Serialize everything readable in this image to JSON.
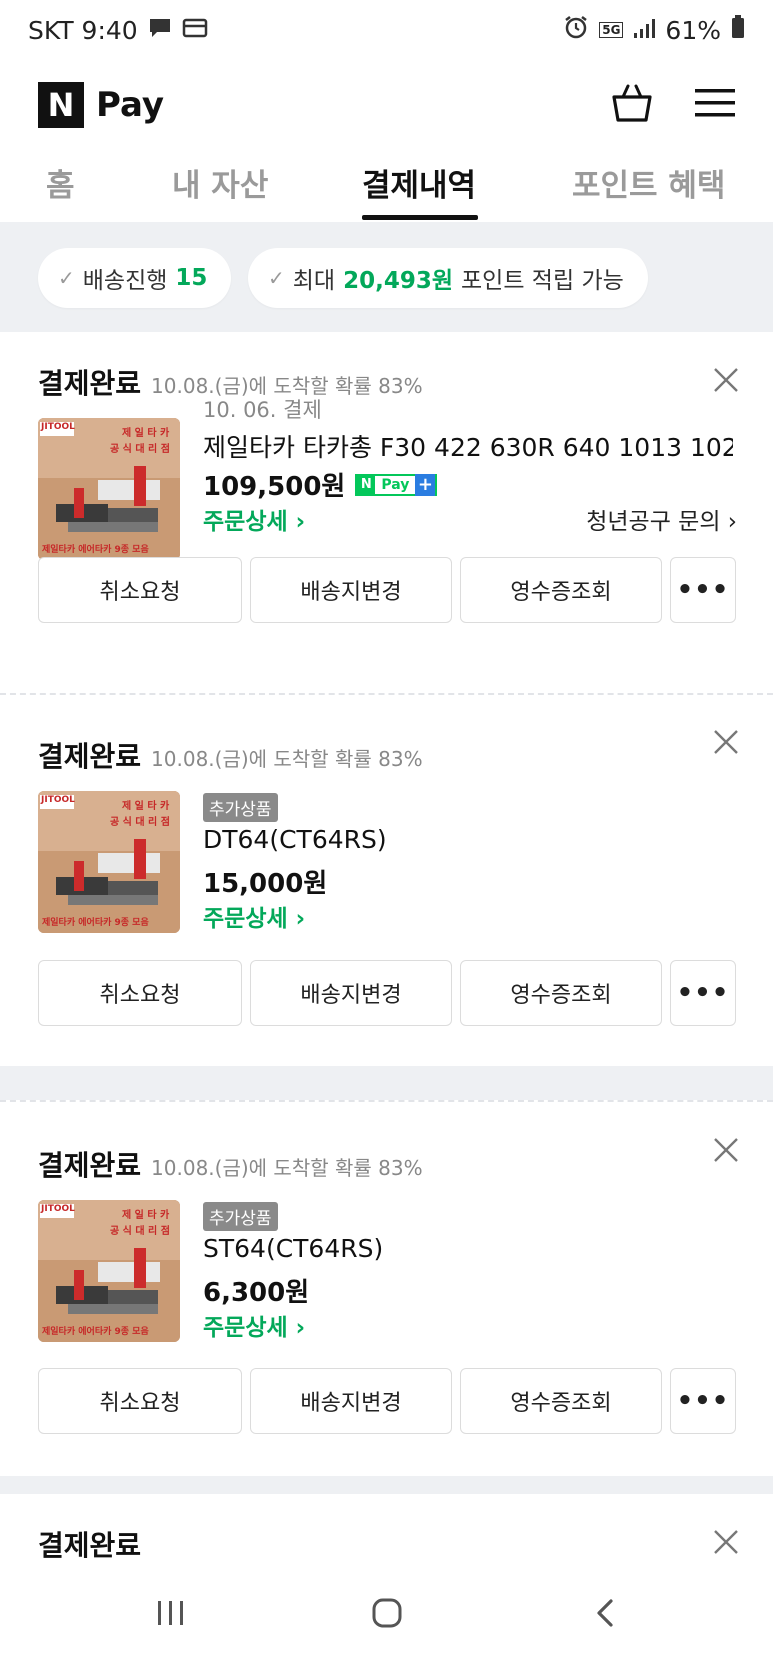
{
  "status_bar": {
    "carrier_time": "SKT 9:40",
    "network": "5G",
    "battery": "61%"
  },
  "header": {
    "logo_letter": "N",
    "logo_text": "Pay"
  },
  "tabs": [
    {
      "label": "홈"
    },
    {
      "label": "내 자산"
    },
    {
      "label": "결제내역"
    },
    {
      "label": "포인트 혜택"
    }
  ],
  "summary": {
    "shipping_label": "배송진행",
    "shipping_count": "15",
    "points_prefix": "최대",
    "points_amount": "20,493원",
    "points_suffix": "포인트 적립 가능"
  },
  "thumbnail": {
    "brand": "JITOOL",
    "line1": "제 일 타 카",
    "line2": "공 식 대 리 점",
    "bottom": "제일타카 에어타카 9종 모음"
  },
  "orders": [
    {
      "status": "결제완료",
      "eta": "10.08.(금)에 도착할 확률 83%",
      "pay_date": "10. 06. 결제",
      "name": "제일타카 타카총 F30 422 630R 640 1013 102...",
      "price": "109,500원",
      "detail": "주문상세 ›",
      "seller": "청년공구 문의 ›",
      "buttons": [
        "취소요청",
        "배송지변경",
        "영수증조회",
        "•••"
      ]
    },
    {
      "status": "결제완료",
      "eta": "10.08.(금)에 도착할 확률 83%",
      "tag": "추가상품",
      "name": "DT64(CT64RS)",
      "price": "15,000원",
      "detail": "주문상세 ›",
      "buttons": [
        "취소요청",
        "배송지변경",
        "영수증조회",
        "•••"
      ]
    },
    {
      "status": "결제완료",
      "eta": "10.08.(금)에 도착할 확률 83%",
      "tag": "추가상품",
      "name": "ST64(CT64RS)",
      "price": "6,300원",
      "detail": "주문상세 ›",
      "buttons": [
        "취소요청",
        "배송지변경",
        "영수증조회",
        "•••"
      ]
    },
    {
      "status": "결제완료"
    }
  ],
  "npay_badge": {
    "n": "N",
    "pay": "Pay",
    "plus": "+"
  },
  "colors": {
    "green": "#03a85a",
    "gray_bg": "#eef0f3"
  }
}
